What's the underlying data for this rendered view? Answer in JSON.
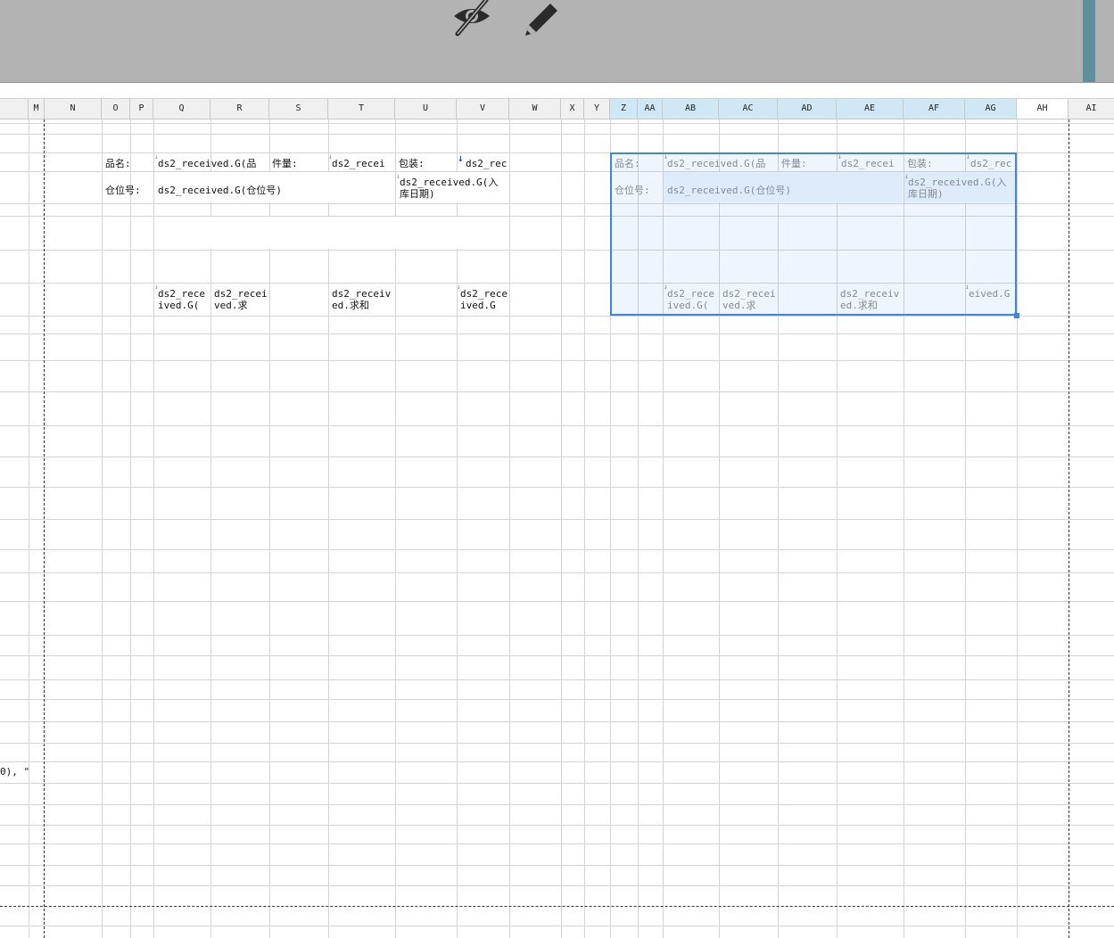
{
  "toolbar": {
    "icons": [
      "eye-slash-icon",
      "pencil-icon"
    ]
  },
  "column_headers": [
    "M",
    "N",
    "O",
    "P",
    "Q",
    "R",
    "S",
    "T",
    "U",
    "V",
    "W",
    "X",
    "Y",
    "Z",
    "AA",
    "AB",
    "AC",
    "AD",
    "AE",
    "AF",
    "AG",
    "AH",
    "AI"
  ],
  "selected_columns": [
    "Z",
    "AA",
    "AB",
    "AC",
    "AD",
    "AE",
    "AF",
    "AG"
  ],
  "left_block": {
    "product_label": "品名:",
    "product_value": "ds2_received.G(品",
    "qty_label": "件量:",
    "qty_value": "ds2_recei",
    "pack_label": "包装:",
    "pack_value": "ds2_rec",
    "loc_label": "仓位号:",
    "loc_value": "ds2_received.G(仓位号)",
    "date_value": "ds2_received.G(入库日期)",
    "row3_q": "ds2_received.G(",
    "row3_r": "ds2_received.求",
    "row3_t": "ds2_received.求和",
    "row3_v": "ds2_received.G"
  },
  "right_block": {
    "product_label": "品名:",
    "product_value": "ds2_received.G(品",
    "qty_label": "件量:",
    "qty_value": "ds2_recei",
    "pack_label": "包装:",
    "pack_value": "ds2_rec",
    "loc_label": "仓位号:",
    "loc_value": "ds2_received.G(仓位号)",
    "date_value": "ds2_received.G(入库日期)",
    "row3_ab": "ds2_received.G(",
    "row3_ac": "ds2_received.求",
    "row3_ae": "ds2_received.求和",
    "row3_ag": "eived.G"
  },
  "left_edge_fragment": "0), \""
}
